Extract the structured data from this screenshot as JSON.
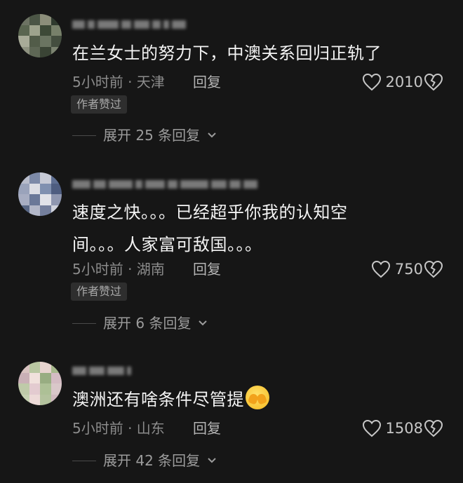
{
  "comments": [
    {
      "text": "在兰女士的努力下，中澳关系回归正轨了",
      "time": "5小时前 · 天津",
      "reply": "回复",
      "likes": "2010",
      "badge": "作者赞过",
      "expand": "展开 25 条回复",
      "avatar_colors": [
        "#6d7363",
        "#4b5545",
        "#8c8e7a",
        "#2f3a2e",
        "#5a6550",
        "#9ea38d",
        "#3d4937",
        "#77806a",
        "#a8ab98",
        "#525c49",
        "#6a7461",
        "#444e3f",
        "#8e9280",
        "#5e6755",
        "#3a4435",
        "#7b8370"
      ]
    },
    {
      "text_line1": "速度之快。。。已经超乎你我的认知空",
      "text_line2": "间。。。人家富可敌国。。。",
      "time": "5小时前 · 湖南",
      "reply": "回复",
      "likes": "750",
      "badge": "作者赞过",
      "expand": "展开 6 条回复",
      "avatar_colors": [
        "#b8bccb",
        "#7d8aa8",
        "#c7cad6",
        "#5f6f92",
        "#9aa3bb",
        "#dcdde4",
        "#8090b0",
        "#4e5d80",
        "#a7adc2",
        "#6a7898",
        "#e1e2e8",
        "#8f97b0",
        "#596785",
        "#b2b7c8",
        "#747f9c",
        "#cfd2dc"
      ]
    },
    {
      "text": "澳洲还有啥条件尽管提",
      "time": "5小时前 · 山东",
      "reply": "回复",
      "likes": "1508",
      "expand": "展开 42 条回复",
      "avatar_colors": [
        "#d8c3c0",
        "#b9c7a2",
        "#e7d4cf",
        "#a8b98e",
        "#c9b0b6",
        "#f0e1dc",
        "#98ad82",
        "#d4bcc3",
        "#bfcaa9",
        "#e3cbd0",
        "#adc096",
        "#d9c7c9",
        "#c6d1b2",
        "#eddad8",
        "#b3c29d",
        "#d0b9bf"
      ]
    }
  ],
  "icons": {
    "like": "heart-outline-icon",
    "dislike": "broken-heart-icon",
    "expand": "chevron-down-icon"
  }
}
